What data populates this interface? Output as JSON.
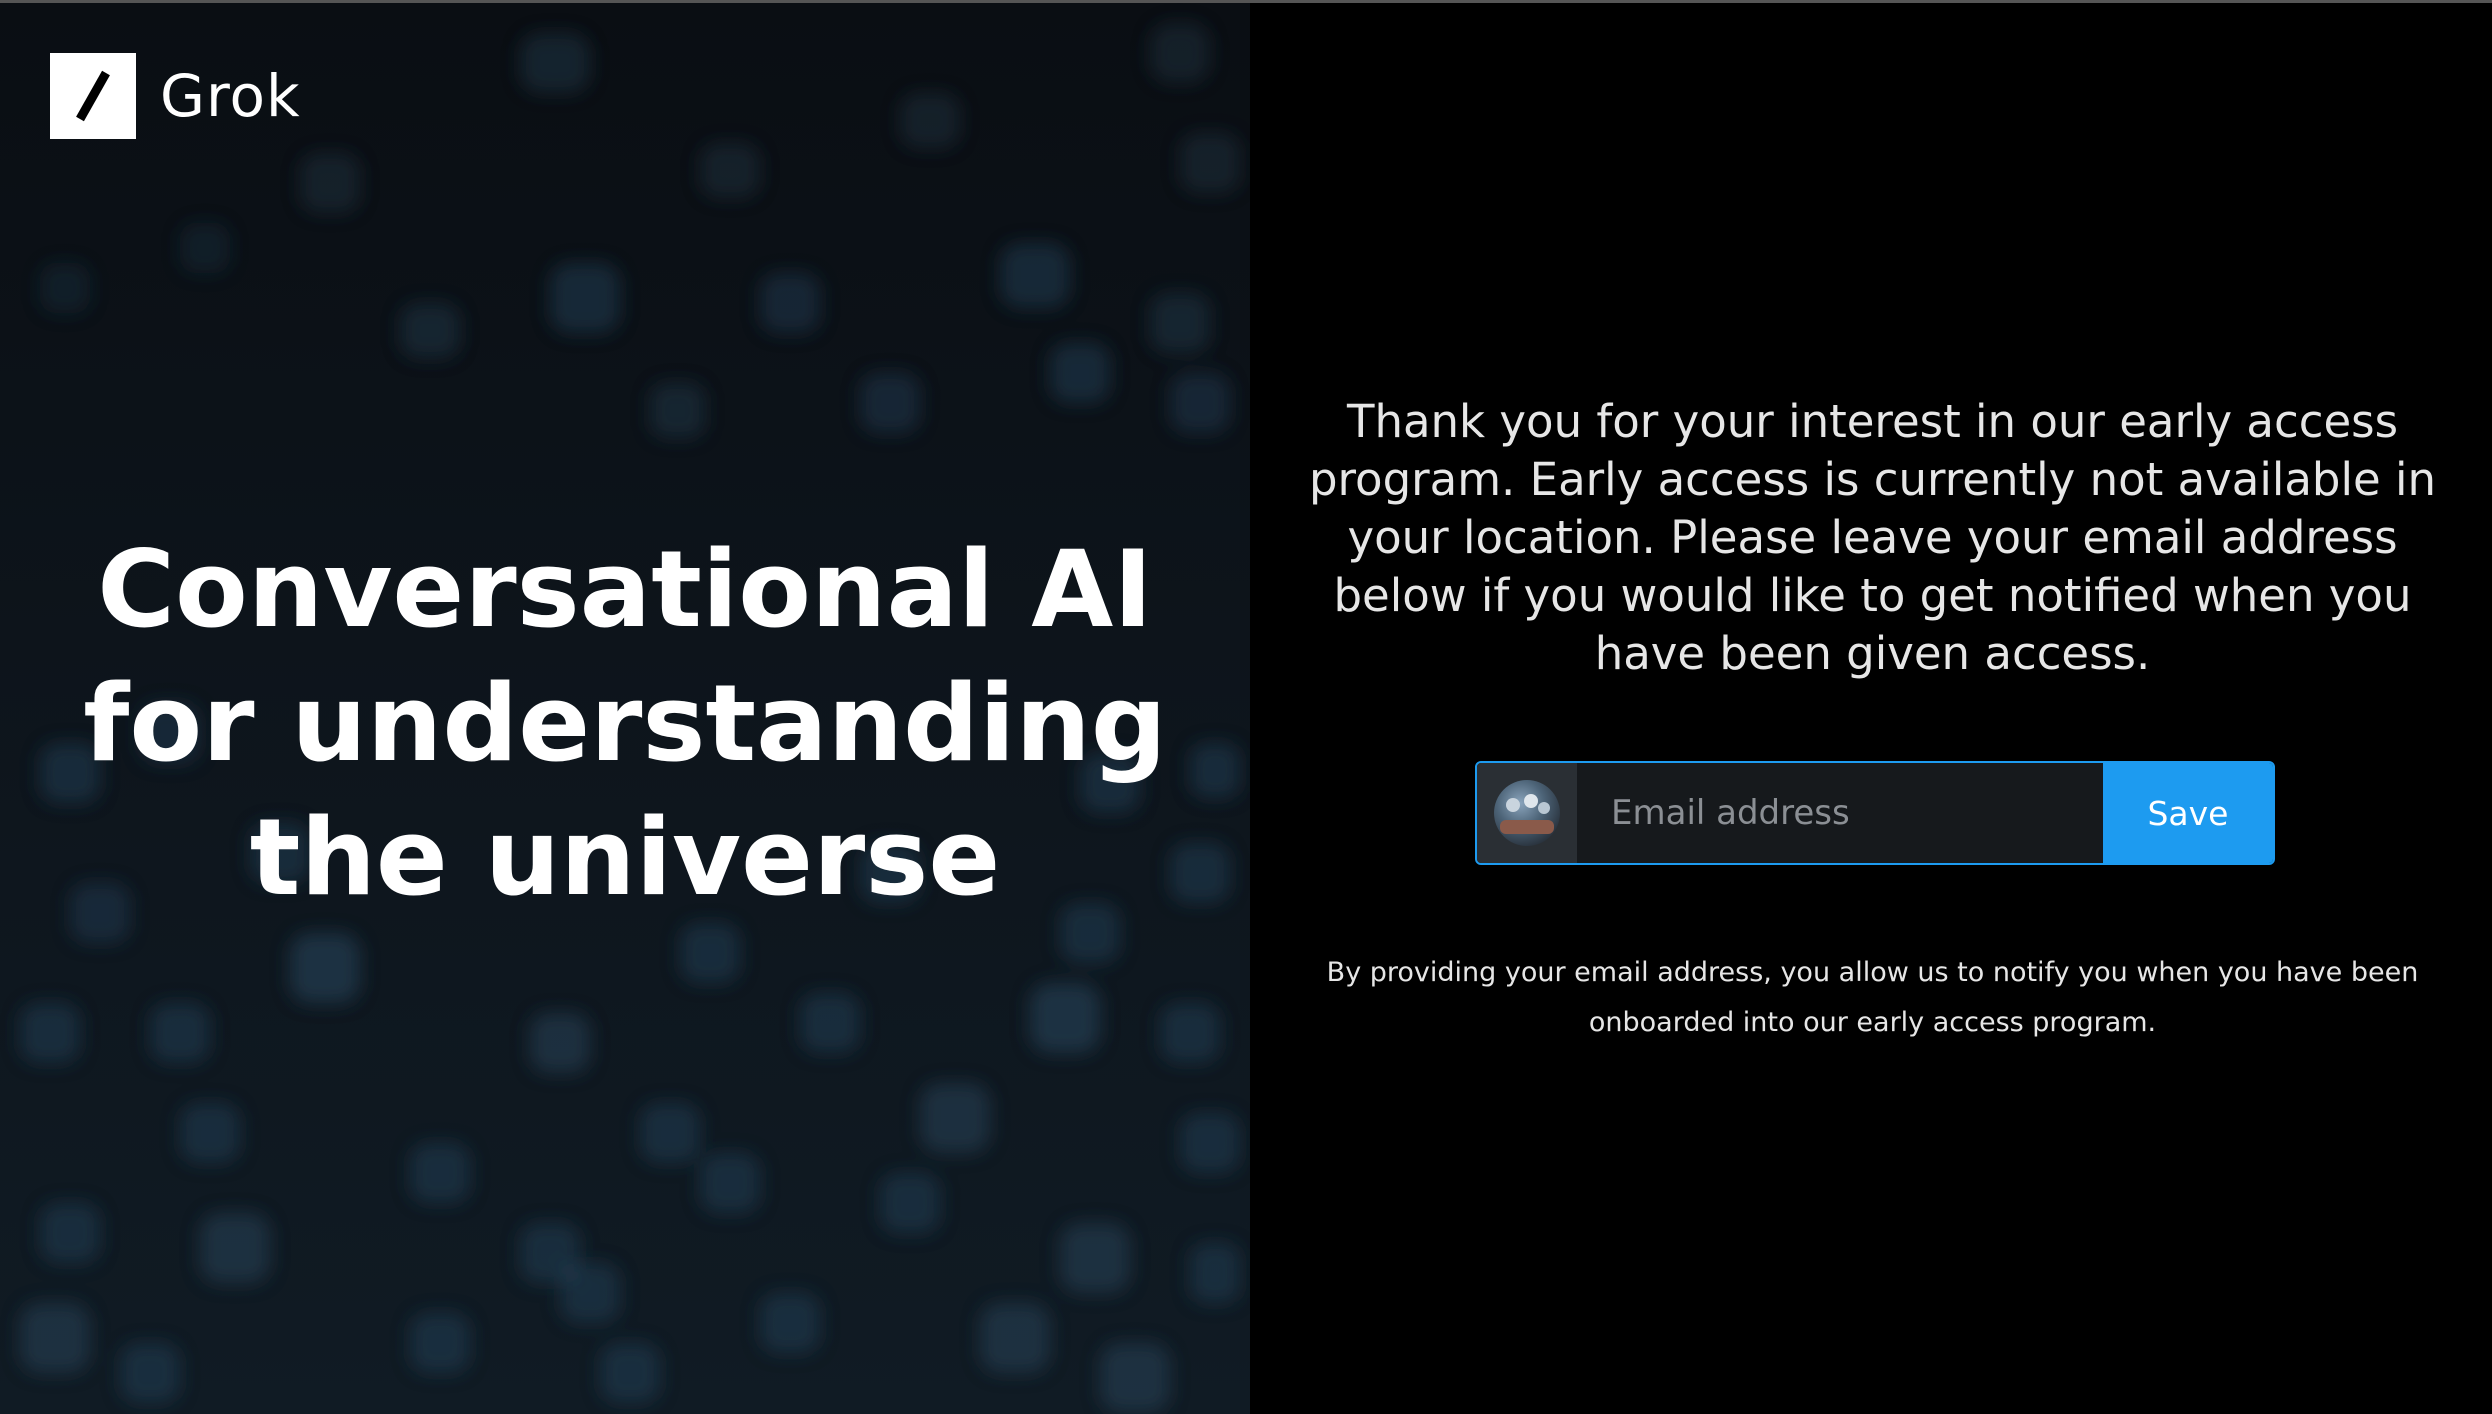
{
  "brand": {
    "name": "Grok",
    "logo_icon": "slash-logo-icon"
  },
  "hero": {
    "headline": "Conversational AI for understanding the universe"
  },
  "signup": {
    "message": "Thank you for your interest in our early access program. Early access is currently not available in your location. Please leave your email address below if you would like to get notified when you have been given access.",
    "email_placeholder": "Email address",
    "email_value": "",
    "save_label": "Save",
    "avatar_icon": "user-avatar",
    "disclaimer": "By providing your email address, you allow us to notify you when you have been onboarded into our early access program."
  },
  "colors": {
    "accent": "#1d9bf0",
    "background": "#000000",
    "left_panel": "#0d141b"
  }
}
